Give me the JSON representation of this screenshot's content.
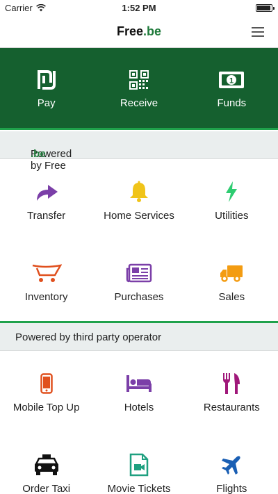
{
  "status_bar": {
    "carrier": "Carrier",
    "time": "1:52 PM"
  },
  "nav": {
    "title_main": "Free",
    "title_suffix": ".be"
  },
  "hero": {
    "background": "#15602f",
    "items": [
      {
        "label": "Pay",
        "icon": "shekel-icon"
      },
      {
        "label": "Receive",
        "icon": "qr-code-icon"
      },
      {
        "label": "Funds",
        "icon": "banknote-icon"
      }
    ]
  },
  "section_freebe": {
    "header_prefix": "Powered by Free",
    "header_suffix": ".be",
    "items": [
      {
        "label": "Transfer",
        "icon": "forward-arrow-icon",
        "color": "#7b3fa8"
      },
      {
        "label": "Home Services",
        "icon": "bell-icon",
        "color": "#f0c419"
      },
      {
        "label": "Utilities",
        "icon": "lightning-icon",
        "color": "#2ecc71"
      },
      {
        "label": "Inventory",
        "icon": "cart-icon",
        "color": "#e0501e"
      },
      {
        "label": "Purchases",
        "icon": "newspaper-icon",
        "color": "#7b3fa8"
      },
      {
        "label": "Sales",
        "icon": "truck-icon",
        "color": "#f39c12"
      }
    ]
  },
  "section_third_party": {
    "header": "Powered by third party operator",
    "items": [
      {
        "label": "Mobile Top Up",
        "icon": "mobile-phone-icon",
        "color": "#e0501e"
      },
      {
        "label": "Hotels",
        "icon": "bed-icon",
        "color": "#7b3fa8"
      },
      {
        "label": "Restaurants",
        "icon": "cutlery-icon",
        "color": "#a0187a"
      },
      {
        "label": "Order Taxi",
        "icon": "taxi-icon",
        "color": "#111111"
      },
      {
        "label": "Movie Tickets",
        "icon": "video-file-icon",
        "color": "#1fa080"
      },
      {
        "label": "Flights",
        "icon": "plane-icon",
        "color": "#1a5fb4"
      }
    ]
  }
}
